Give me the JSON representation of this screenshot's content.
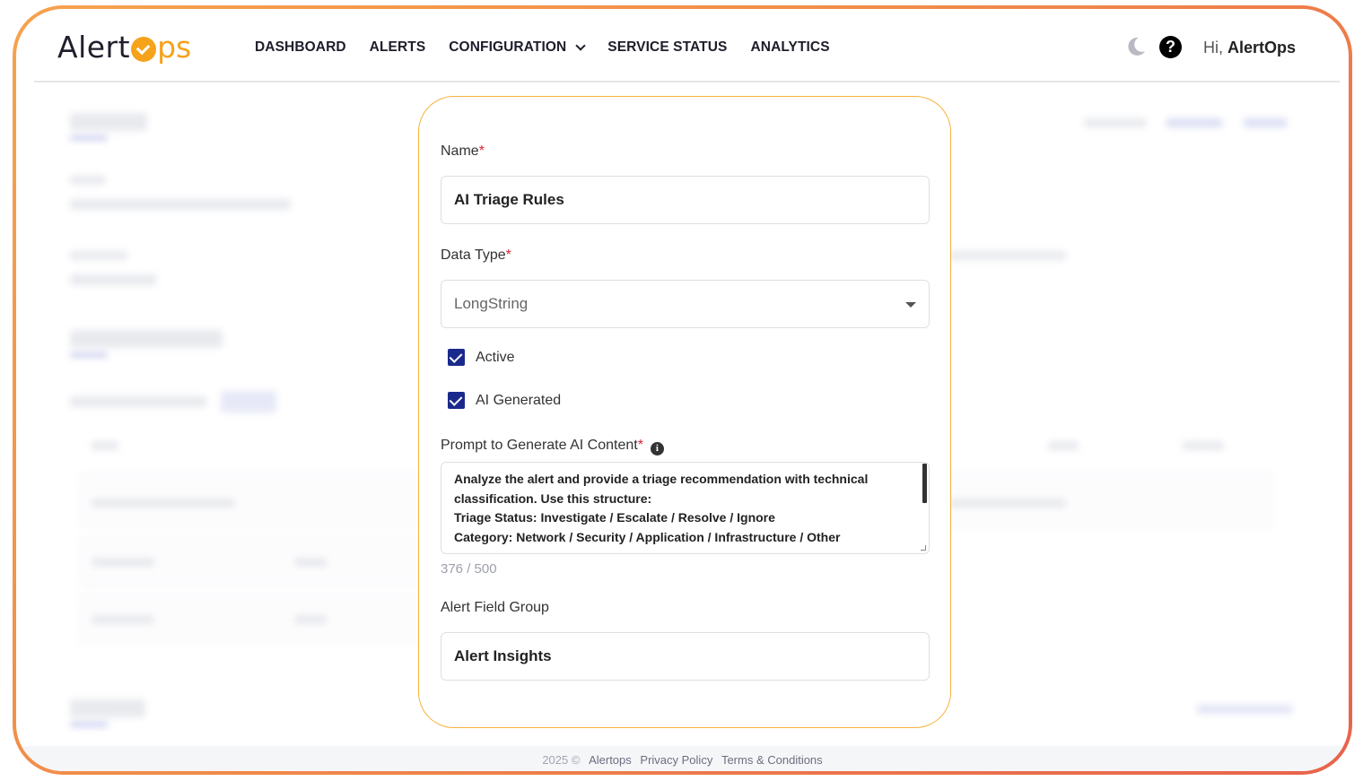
{
  "header": {
    "logo_main": "Alert",
    "logo_tail": "ps",
    "nav": [
      "DASHBOARD",
      "ALERTS",
      "CONFIGURATION",
      "SERVICE STATUS",
      "ANALYTICS"
    ],
    "greeting_prefix": "Hi,",
    "greeting_name": "AlertOps"
  },
  "modal": {
    "name_label": "Name",
    "name_value": "AI Triage Rules",
    "data_type_label": "Data Type",
    "data_type_value": "LongString",
    "active_label": "Active",
    "ai_generated_label": "AI Generated",
    "prompt_label": "Prompt to Generate AI Content",
    "prompt_lines": [
      "Analyze the alert and provide a triage recommendation with technical",
      "classification. Use this structure:",
      "Triage Status: Investigate / Escalate / Resolve / Ignore",
      "Category: Network / Security / Application / Infrastructure / Other"
    ],
    "prompt_counter": "376 / 500",
    "field_group_label": "Alert Field Group",
    "field_group_value": "Alert Insights",
    "required_mark": "*"
  },
  "footer": {
    "year": "2025 ©",
    "company": "Alertops",
    "privacy": "Privacy Policy",
    "terms": "Terms & Conditions"
  },
  "colors": {
    "accent": "#f7a21b",
    "frame_start": "#f6a24e",
    "frame_end": "#e8634c",
    "checkbox": "#1a2a8c",
    "modal_border": "#f6b23a"
  }
}
